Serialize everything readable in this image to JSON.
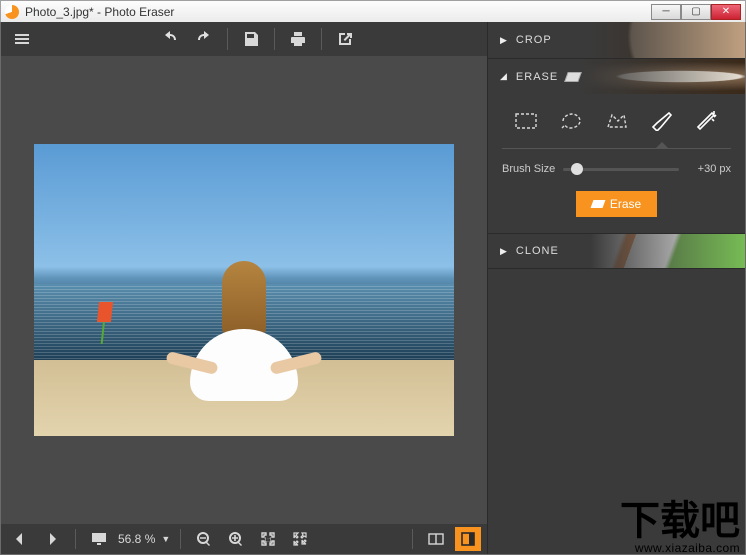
{
  "window": {
    "title": "Photo_3.jpg* - Photo Eraser"
  },
  "toolbar": {
    "menu": "menu",
    "undo": "undo",
    "redo": "redo",
    "save": "save",
    "print": "print",
    "share": "share"
  },
  "panels": {
    "crop": {
      "label": "CROP"
    },
    "erase": {
      "label": "ERASE",
      "tools": {
        "rect": "rectangle-select",
        "lasso": "lasso-select",
        "poly": "polygon-select",
        "brush": "brush-select",
        "magic": "magic-wand"
      },
      "brush_label": "Brush Size",
      "brush_value": "+30 px",
      "button": "Erase"
    },
    "clone": {
      "label": "CLONE"
    }
  },
  "status": {
    "zoom_value": "56.8 %"
  },
  "watermark": {
    "text": "下载吧",
    "url": "www.xiazaiba.com"
  }
}
